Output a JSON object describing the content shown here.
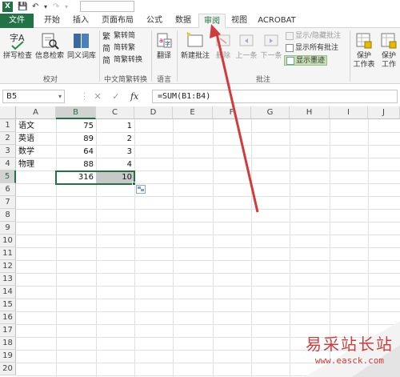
{
  "app": {
    "logo": "X",
    "title_value": ""
  },
  "tabs": [
    {
      "label": "文件",
      "kind": "file"
    },
    {
      "label": "开始"
    },
    {
      "label": "插入"
    },
    {
      "label": "页面布局"
    },
    {
      "label": "公式"
    },
    {
      "label": "数据"
    },
    {
      "label": "审阅",
      "active": true
    },
    {
      "label": "视图"
    },
    {
      "label": "ACROBAT"
    }
  ],
  "ribbon": {
    "proofing": {
      "spell": "拼写检查",
      "research": "信息检索",
      "thesaurus": "同义词库",
      "label": "校对"
    },
    "chinese": {
      "trad_to_simp": "繁转简",
      "simp_to_trad": "简转繁",
      "convert": "简繁转换",
      "label": "中文简繁转换"
    },
    "language": {
      "translate": "翻译",
      "label": "语言"
    },
    "comments": {
      "new": "新建批注",
      "delete": "删除",
      "prev": "上一条",
      "next": "下一条",
      "show_hide": "显示/隐藏批注",
      "show_all": "显示所有批注",
      "show_ink": "显示墨迹",
      "label": "批注"
    },
    "protect": {
      "sheet": "保护工作表",
      "workbook": "保护工作簿",
      "sheet_l1": "保护",
      "sheet_l2": "工作表",
      "wb_l1": "保护",
      "wb_l2": "工作"
    }
  },
  "formula_bar": {
    "name_box": "B5",
    "cancel": "✕",
    "enter": "✓",
    "fx": "fx",
    "formula": "=SUM(B1:B4)"
  },
  "columns": [
    "A",
    "B",
    "C",
    "D",
    "E",
    "F",
    "G",
    "H",
    "I",
    "J"
  ],
  "rows": [
    "1",
    "2",
    "3",
    "4",
    "5",
    "6",
    "7",
    "8",
    "9",
    "10",
    "11",
    "12",
    "13",
    "14",
    "15",
    "16",
    "17",
    "18",
    "19",
    "20"
  ],
  "cells": {
    "A1": "语文",
    "B1": "75",
    "C1": "1",
    "A2": "英语",
    "B2": "89",
    "C2": "2",
    "A3": "数学",
    "B3": "64",
    "C3": "3",
    "A4": "物理",
    "B4": "88",
    "C4": "4",
    "B5": "316",
    "C5": "10"
  },
  "watermark": {
    "main": "易采站长站",
    "sub": "www.easck.com"
  },
  "colors": {
    "excel_green": "#217346",
    "arrow_red": "#d23b3b"
  }
}
